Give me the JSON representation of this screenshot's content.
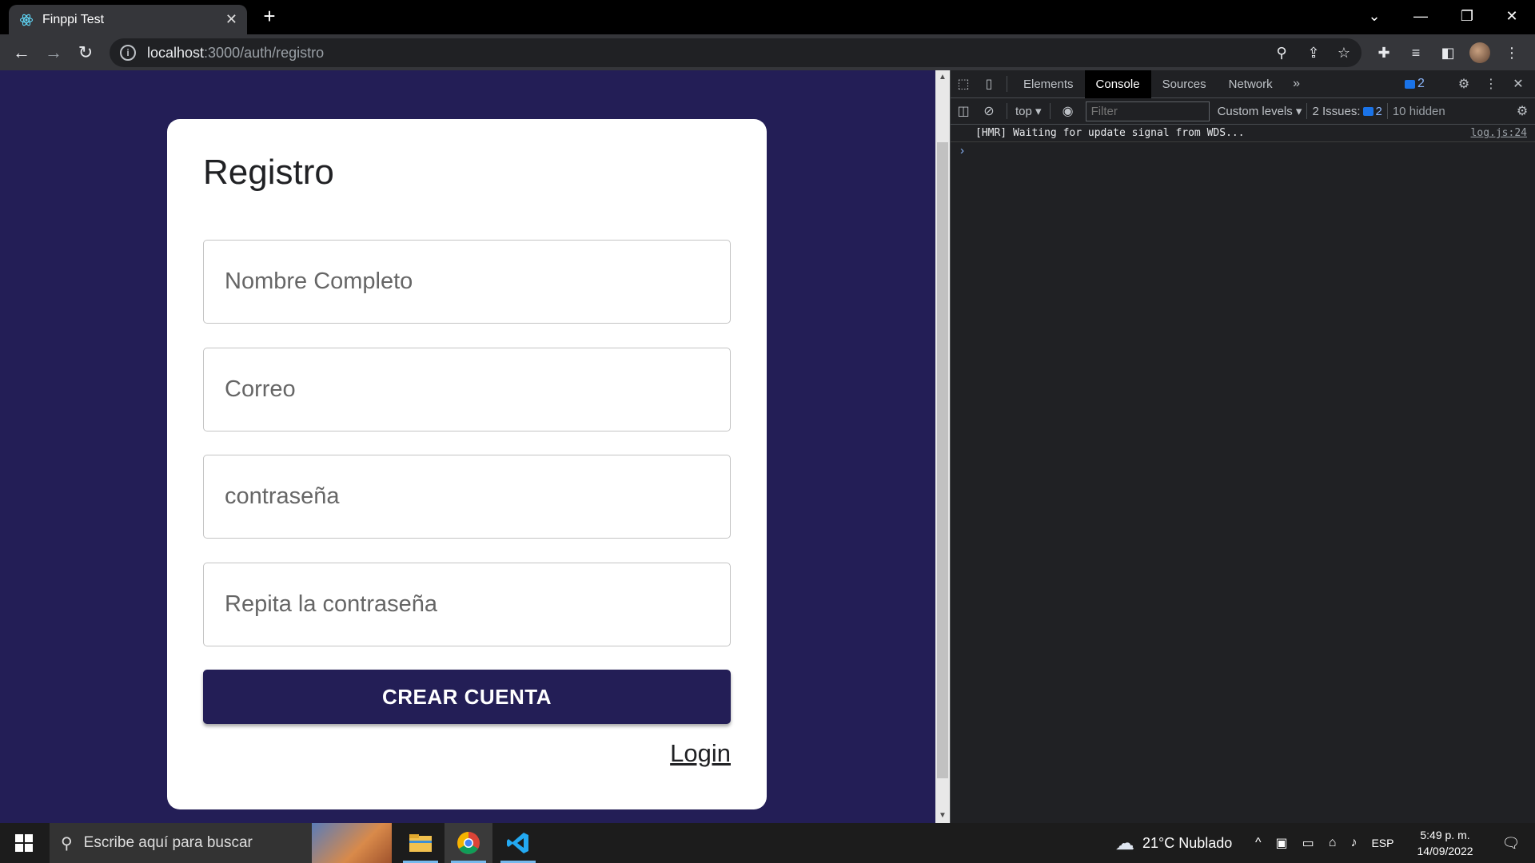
{
  "browser": {
    "tab_title": "Finppi Test",
    "url_host": "localhost",
    "url_path": ":3000/auth/registro"
  },
  "form": {
    "title": "Registro",
    "fields": [
      {
        "placeholder": "Nombre Completo"
      },
      {
        "placeholder": "Correo"
      },
      {
        "placeholder": "contraseña"
      },
      {
        "placeholder": "Repita la contraseña"
      }
    ],
    "submit_label": "CREAR CUENTA",
    "login_link": "Login"
  },
  "devtools": {
    "tabs": [
      "Elements",
      "Console",
      "Sources",
      "Network"
    ],
    "active_tab": "Console",
    "message_count": "2",
    "context": "top",
    "filter_placeholder": "Filter",
    "levels": "Custom levels",
    "issues_label": "2 Issues:",
    "issues_count": "2",
    "hidden": "10 hidden",
    "console_message": "[HMR] Waiting for update signal from WDS...",
    "console_source": "log.js:24"
  },
  "taskbar": {
    "search_placeholder": "Escribe aquí para buscar",
    "weather": "21°C  Nublado",
    "language": "ESP",
    "time": "5:49 p. m.",
    "date": "14/09/2022"
  },
  "colors": {
    "page_bg": "#231e56",
    "button_bg": "#231e56",
    "card_bg": "#ffffff"
  }
}
